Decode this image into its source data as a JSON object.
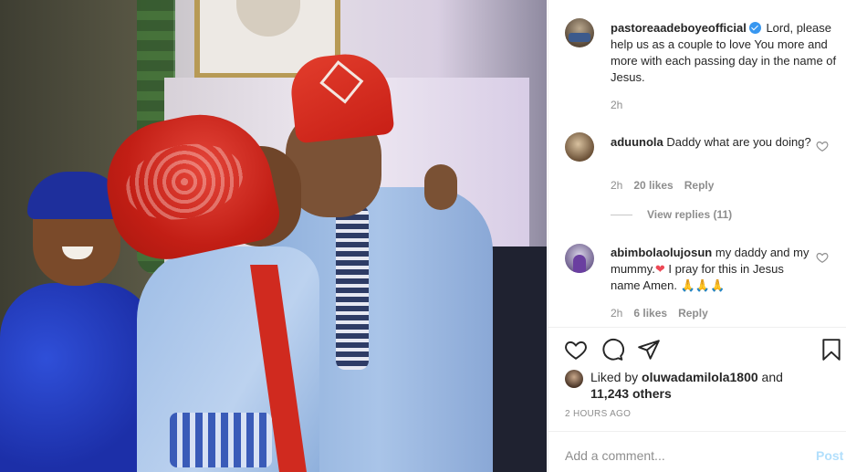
{
  "post": {
    "author": "pastoreaadeboyeofficial",
    "caption": "Lord, please help us as a couple to love You more and more with each passing day in the name of Jesus.",
    "caption_time": "2h",
    "photo_alt": "Couple in matching light blue and red traditional attire"
  },
  "comments": [
    {
      "username": "aduunola",
      "text": "Daddy what are you doing?",
      "time": "2h",
      "likes": "20 likes",
      "reply_label": "Reply"
    },
    {
      "username": "abimbolaolujosun",
      "text_before_emoji": "my daddy and my mummy.",
      "emoji_heart": "❤",
      "text_after_emoji": " I pray for this in Jesus name Amen. 🙏🙏🙏",
      "time": "2h",
      "likes": "6 likes",
      "reply_label": "Reply"
    }
  ],
  "view_replies": "View replies (11)",
  "likes": {
    "prefix": "Liked by",
    "user": "oluwadamilola1800",
    "joiner": "and",
    "others": "11,243 others"
  },
  "post_time": "2 HOURS AGO",
  "add_comment": {
    "placeholder": "Add a comment...",
    "post_label": "Post"
  },
  "colors": {
    "accent_blue": "#3897f0",
    "post_button_disabled": "#b2dffc",
    "heart_red": "#ed4956"
  }
}
